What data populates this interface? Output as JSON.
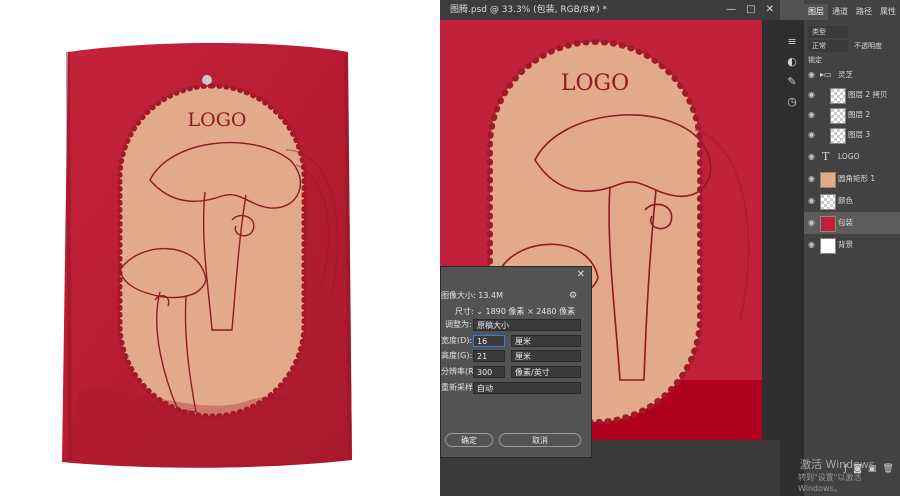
{
  "product": {
    "logo_text": "LOGO"
  },
  "document": {
    "title": "图腾.psd @ 33.3% (包装, RGB/8#) *",
    "canvas_logo": "LOGO"
  },
  "window_controls": {
    "minimize": "—",
    "maximize": "□",
    "close": "✕"
  },
  "panel": {
    "tabs": [
      "图层",
      "通道",
      "路径",
      "属性"
    ],
    "kind_filter": "类型",
    "blend_mode": "正常",
    "opacity_label": "不透明度",
    "lock_label": "锁定"
  },
  "layers": [
    {
      "name": "灵芝",
      "type": "group"
    },
    {
      "name": "图层 2 拷贝",
      "type": "pixel"
    },
    {
      "name": "图层 2",
      "type": "pixel"
    },
    {
      "name": "图层 3",
      "type": "pixel"
    },
    {
      "name": "LOGO",
      "type": "text"
    },
    {
      "name": "圆角矩形 1",
      "type": "shape"
    },
    {
      "name": "颜色",
      "type": "pixel"
    },
    {
      "name": "包装",
      "type": "pixel",
      "selected": true
    },
    {
      "name": "背景",
      "type": "pixel"
    }
  ],
  "image_size_dialog": {
    "image_size_label": "图像大小:",
    "image_size_value": "13.4M",
    "dimensions_label": "尺寸:",
    "dimensions_value": "1890 像素 × 2480 像素",
    "fit_to_label": "调整为:",
    "fit_to_value": "原稿大小",
    "width_label": "宽度(D):",
    "width_value": "16",
    "width_unit": "厘米",
    "height_label": "高度(G):",
    "height_value": "21",
    "height_unit": "厘米",
    "resolution_label": "分辨率(R):",
    "resolution_value": "300",
    "resolution_unit": "像素/英寸",
    "resample_label": "重新采样(S):",
    "resample_value": "自动",
    "ok_label": "确定",
    "cancel_label": "取消"
  },
  "os_watermark": {
    "line1": "激活 Windows",
    "line2": "转到\"设置\"以激活 Windows。"
  },
  "colors": {
    "bag_red": "#c0203a",
    "label_peach": "#e2a98a",
    "ink_red": "#8e1a26"
  }
}
